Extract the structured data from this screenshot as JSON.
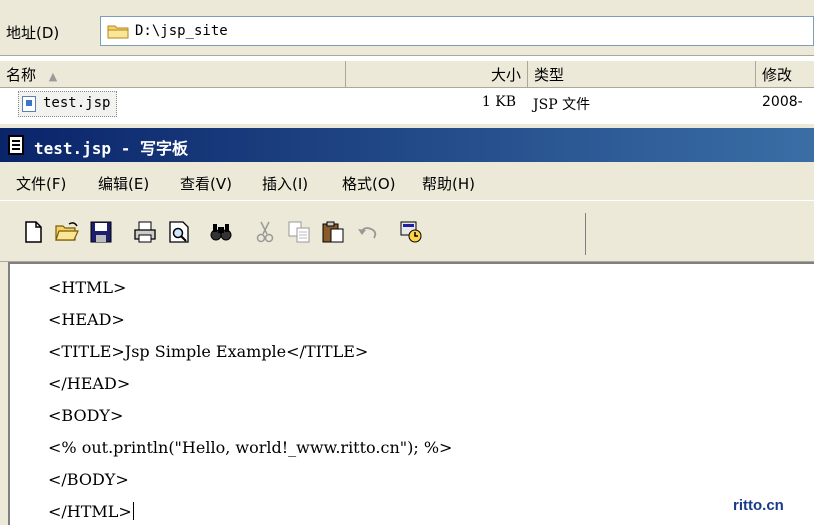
{
  "address_bar": {
    "label": "地址(D)",
    "path": "D:\\jsp_site"
  },
  "explorer": {
    "columns": [
      "名称",
      "大小",
      "类型",
      "修改"
    ],
    "files": [
      {
        "name": "test.jsp",
        "size": "1 KB",
        "type": "JSP 文件",
        "modified": "2008-"
      }
    ]
  },
  "window": {
    "title": "test.jsp - 写字板"
  },
  "menu": [
    "文件(F)",
    "编辑(E)",
    "查看(V)",
    "插入(I)",
    "格式(O)",
    "帮助(H)"
  ],
  "toolbar": {
    "buttons": [
      "new-icon",
      "open-icon",
      "save-icon",
      "print-icon",
      "print-preview-icon",
      "find-icon",
      "cut-icon",
      "copy-icon",
      "paste-icon",
      "undo-icon",
      "insert-datetime-icon"
    ]
  },
  "document": {
    "lines": [
      "<HTML>",
      "<HEAD>",
      "<TITLE>Jsp Simple Example</TITLE>",
      "</HEAD>",
      "<BODY>",
      "<% out.println(\"Hello, world!_www.ritto.cn\"); %>",
      "</BODY>",
      "</HTML>"
    ]
  },
  "watermark": "ritto.cn",
  "colors": {
    "titlebar": "#0a246a",
    "chrome": "#ece9d8",
    "watermark": "#1a3a8a"
  }
}
